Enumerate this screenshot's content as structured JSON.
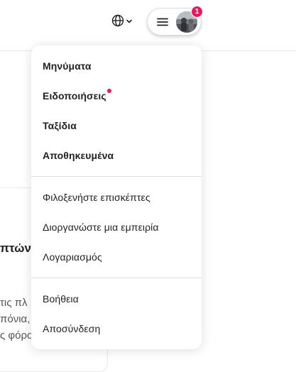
{
  "header": {
    "language_icon": "globe-icon",
    "language_caret": "chevron-down-icon",
    "menu_icon": "hamburger-icon",
    "notification_count": "1",
    "badge_color": "#e31c5f"
  },
  "background": {
    "title_fragment": "πτών",
    "lines": [
      "τις πλ",
      "πόνια,",
      "ς φόρο"
    ]
  },
  "menu": {
    "sections": [
      {
        "items": [
          {
            "label": "Μηνύματα",
            "bold": true
          },
          {
            "label": "Ειδοποιήσεις",
            "bold": true,
            "has_dot": true
          },
          {
            "label": "Ταξίδια",
            "bold": true
          },
          {
            "label": "Αποθηκευμένα",
            "bold": true
          }
        ]
      },
      {
        "items": [
          {
            "label": "Φιλοξενήστε επισκέπτες"
          },
          {
            "label": "Διοργανώστε μια εμπειρία"
          },
          {
            "label": "Λογαριασμός"
          }
        ]
      },
      {
        "items": [
          {
            "label": "Βοήθεια"
          },
          {
            "label": "Αποσύνδεση"
          }
        ]
      }
    ]
  }
}
